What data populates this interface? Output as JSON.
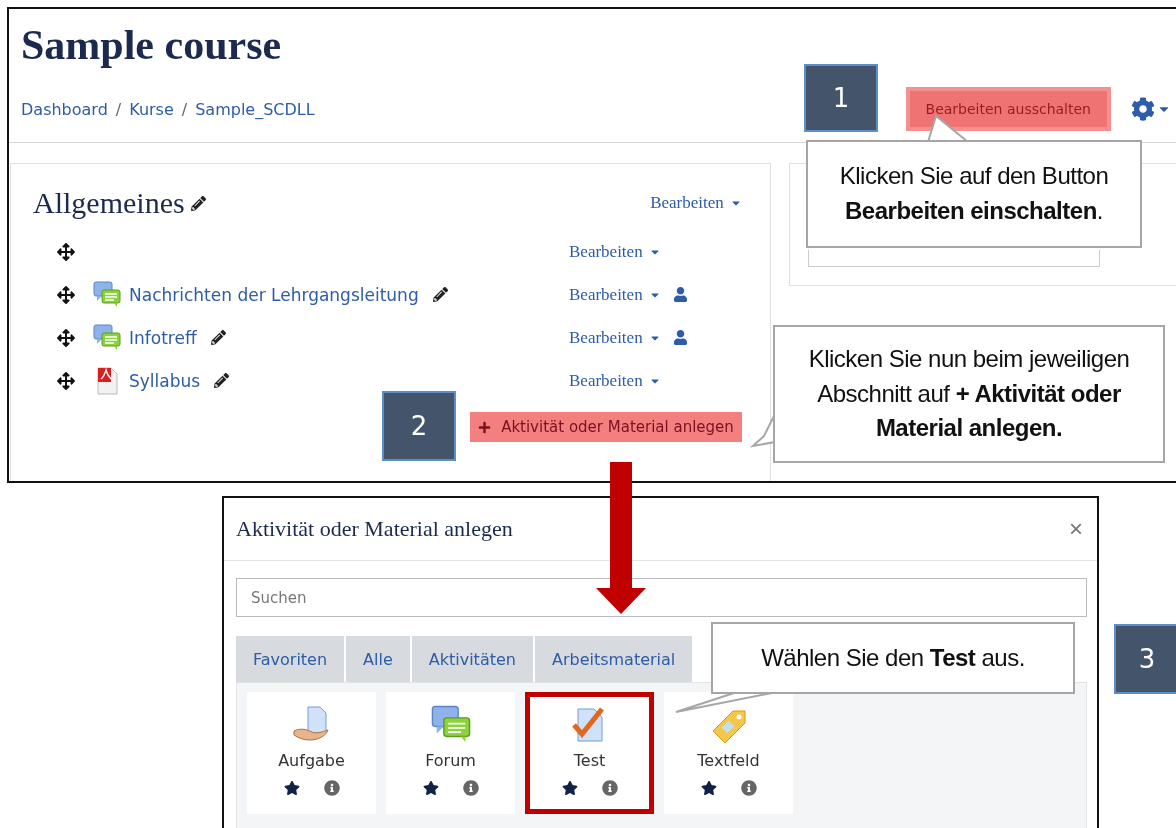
{
  "course_page": {
    "title": "Sample course",
    "breadcrumb": [
      "Dashboard",
      "Kurse",
      "Sample_SCDLL"
    ],
    "breadcrumb_separator": "/",
    "edit_button": {
      "label": "Bearbeiten ausschalten",
      "highlighted": true
    },
    "section": {
      "title": "Allgemeines",
      "menu": "Bearbeiten",
      "activities": [
        {
          "kind": "text",
          "menu": "Bearbeiten",
          "group_icon": false
        },
        {
          "kind": "forum",
          "name": "Nachrichten der Lehrgangsleitung",
          "menu": "Bearbeiten",
          "group_icon": true
        },
        {
          "kind": "forum",
          "name": "Infotreff",
          "menu": "Bearbeiten",
          "group_icon": true
        },
        {
          "kind": "pdf",
          "name": "Syllabus",
          "menu": "Bearbeiten",
          "group_icon": false
        }
      ],
      "add_button": {
        "label": "Aktivität oder Material anlegen",
        "highlighted": true
      }
    }
  },
  "chooser_dialog": {
    "title": "Aktivität oder Material anlegen",
    "close": "×",
    "search": {
      "placeholder": "Suchen"
    },
    "tabs": [
      "Favoriten",
      "Alle",
      "Aktivitäten",
      "Arbeitsmaterial"
    ],
    "modules": [
      {
        "kind": "assignment",
        "name": "Aufgabe",
        "highlighted": false
      },
      {
        "kind": "forum",
        "name": "Forum",
        "highlighted": false
      },
      {
        "kind": "quiz",
        "name": "Test",
        "highlighted": true
      },
      {
        "kind": "label",
        "name": "Textfeld",
        "highlighted": false
      }
    ]
  },
  "annotations": {
    "steps": [
      "1",
      "2",
      "3"
    ],
    "callouts": [
      "Klicken Sie auf den Button **Bearbeiten einschalten**.",
      "Klicken Sie nun beim jeweiligen Abschnitt auf  **+ Aktivität oder Material anlegen.**",
      "Wählen Sie den **Test** aus."
    ]
  }
}
